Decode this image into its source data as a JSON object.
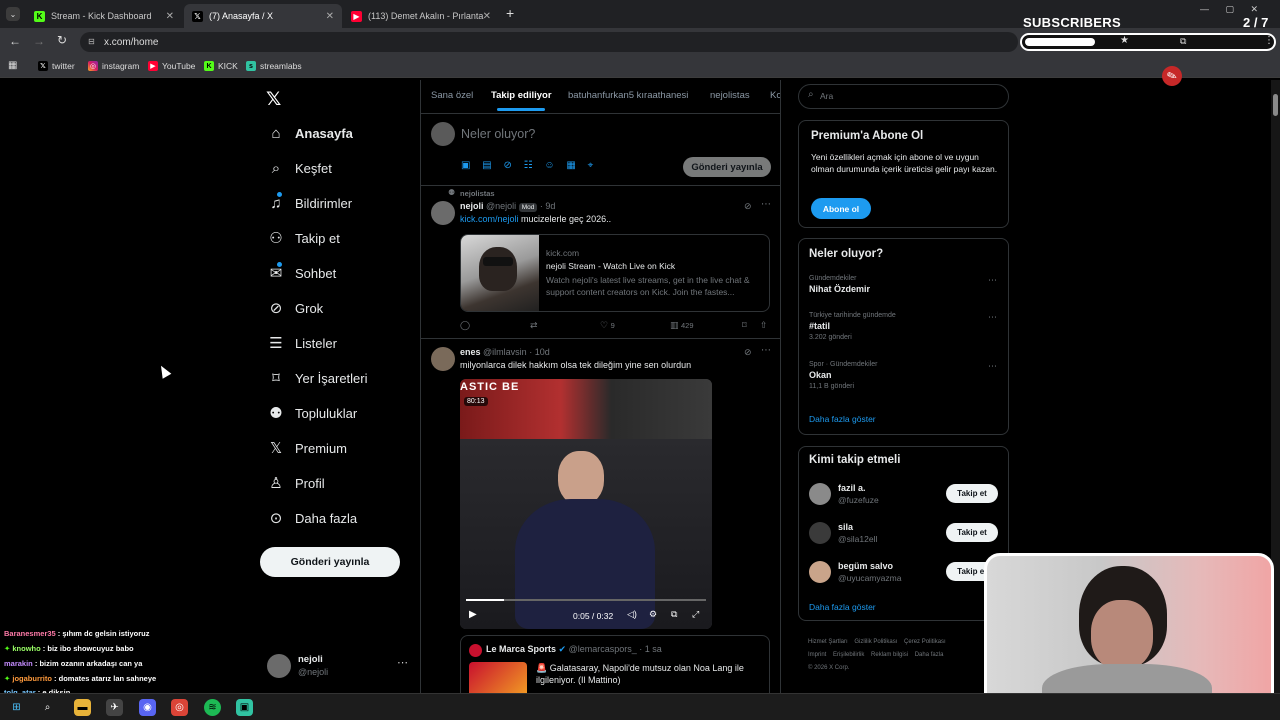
{
  "browser": {
    "tabs": [
      {
        "title": "Stream - Kick Dashboard"
      },
      {
        "title": "(7) Anasayfa / X"
      },
      {
        "title": "(113) Demet Akalın - Pırlanta -"
      }
    ],
    "new_tab": "+",
    "url": "x.com/home",
    "bookmarks": [
      "twitter",
      "instagram",
      "YouTube",
      "KICK",
      "streamlabs"
    ],
    "overlay_subscribers": "SUBSCRIBERS",
    "overlay_count": "2 / 7"
  },
  "x": {
    "nav": [
      "Anasayfa",
      "Keşfet",
      "Bildirimler",
      "Takip et",
      "Sohbet",
      "Grok",
      "Listeler",
      "Yer İşaretleri",
      "Topluluklar",
      "Premium",
      "Profil",
      "Daha fazla"
    ],
    "post_button": "Gönderi yayınla",
    "account_name": "nejoli",
    "account_handle": "@nejoli",
    "tabs": [
      "Sana özel",
      "Takip ediliyor",
      "batuhanfurkan5 kıraathanesi",
      "nejolistas",
      "Ko"
    ],
    "composer_placeholder": "Neler oluyor?",
    "composer_button": "Gönderi yayınla",
    "post1": {
      "community": "nejolistas",
      "name": "nejoli",
      "handle": "@nejoli",
      "badge": "Mod",
      "time": "· 9d",
      "link": "kick.com/nejoli",
      "text": " mucizelerle geç 2026..",
      "card_domain": "kick.com",
      "card_title": "nejoli Stream - Watch Live on Kick",
      "card_desc": "Watch nejoli's latest live streams, get in the live chat & support content creators on Kick. Join the fastes...",
      "likes": "9",
      "views": "429"
    },
    "post2": {
      "name": "enes",
      "handle": "@ilmlavsin",
      "time": "· 10d",
      "text": "milyonlarca dilek hakkım olsa tek dileğim yine sen olurdun",
      "video_badge": "80:13",
      "video_time": "0:05 / 0:32",
      "quote_name": "Le Marca Sports",
      "quote_handle": "@lemarcaspors_ · 1 sa",
      "quote_text": "🚨 Galatasaray, Napoli'de mutsuz olan Noa Lang ile ilgileniyor. (Il Mattino)"
    },
    "search_placeholder": "Ara",
    "premium": {
      "title": "Premium'a Abone Ol",
      "desc": "Yeni özellikleri açmak için abone ol ve uygun olman durumunda içerik üreticisi gelir payı kazan.",
      "button": "Abone ol"
    },
    "trends": {
      "title": "Neler oluyor?",
      "items": [
        {
          "context": "Gündemdekiler",
          "name": "Nihat Özdemir",
          "count": ""
        },
        {
          "context": "Türkiye tarihinde gündemde",
          "name": "#tatil",
          "count": "3.202 gönderi"
        },
        {
          "context": "Spor · Gündemdekiler",
          "name": "Okan",
          "count": "11,1 B gönderi"
        }
      ],
      "more": "Daha fazla göster"
    },
    "who_to_follow": {
      "title": "Kimi takip etmeli",
      "users": [
        {
          "name": "fazil a.",
          "handle": "@fuzefuze",
          "button": "Takip et"
        },
        {
          "name": "sila",
          "handle": "@sila12ell",
          "button": "Takip et"
        },
        {
          "name": "begüm salvo",
          "handle": "@uyucamyazma",
          "button": "Takip et"
        }
      ],
      "more": "Daha fazla göster"
    },
    "footer": [
      "Hizmet Şartları",
      "Gizlilik Politikası",
      "Çerez Politikası",
      "Imprint",
      "Erişilebilirlik",
      "Reklam bilgisi",
      "Daha fazla",
      "© 2026 X Corp."
    ]
  },
  "chat": [
    {
      "user": "Baranesmer35",
      "msg": " : şıhım dc gelsin istiyoruz",
      "color": "#ff7aa8"
    },
    {
      "user": "knowho",
      "msg": " : biz ibo showcuyuz babo",
      "color": "#9aff66"
    },
    {
      "user": "marakin",
      "msg": " : bizim ozanın arkadaşı can ya",
      "color": "#c58cff"
    },
    {
      "user": "jogaburrito",
      "msg": " : domates atarız lan sahneye",
      "color": "#ff9a3c"
    },
    {
      "user": "tolg_atar",
      "msg": " : e diksin",
      "color": "#7ac8ff"
    }
  ]
}
